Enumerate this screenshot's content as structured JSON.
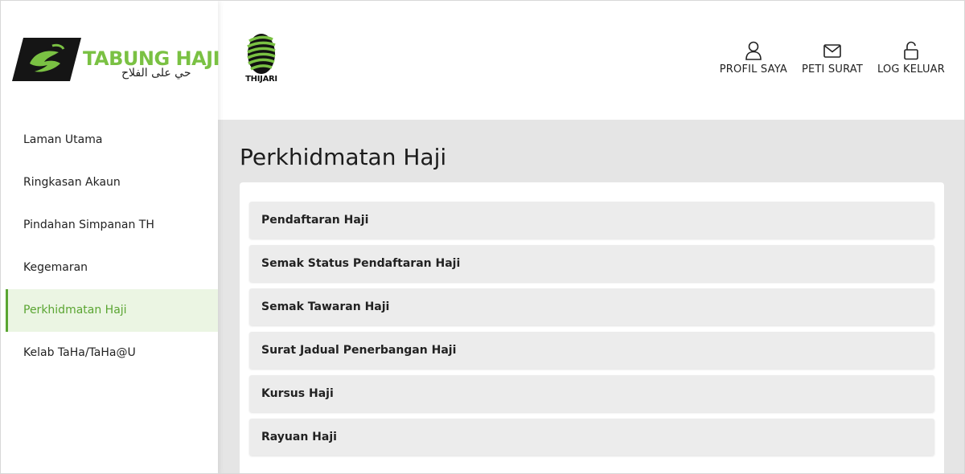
{
  "brand": {
    "name": "TABUNG HAJI",
    "tagline": "حي على الفلاح",
    "accent": "#7ac143"
  },
  "partner_logo": {
    "text": "THIJARI"
  },
  "sidebar": {
    "items": [
      {
        "label": "Laman Utama"
      },
      {
        "label": "Ringkasan Akaun"
      },
      {
        "label": "Pindahan Simpanan TH"
      },
      {
        "label": "Kegemaran"
      },
      {
        "label": "Perkhidmatan Haji",
        "active": true
      },
      {
        "label": "Kelab TaHa/TaHa@U"
      }
    ]
  },
  "header": {
    "profile": {
      "label": "PROFIL SAYA",
      "icon": "user-icon"
    },
    "mail": {
      "label": "PETI SURAT",
      "icon": "envelope-icon"
    },
    "logout": {
      "label": "LOG KELUAR",
      "icon": "unlock-icon"
    }
  },
  "main": {
    "title": "Perkhidmatan Haji",
    "services": [
      {
        "label": "Pendaftaran Haji"
      },
      {
        "label": "Semak Status Pendaftaran Haji"
      },
      {
        "label": "Semak Tawaran Haji"
      },
      {
        "label": "Surat Jadual Penerbangan Haji"
      },
      {
        "label": "Kursus Haji"
      },
      {
        "label": "Rayuan Haji"
      }
    ]
  },
  "colors": {
    "active_bg": "#ebf5e3",
    "active_text": "#5aa532",
    "content_bg": "#e5e5e5"
  }
}
